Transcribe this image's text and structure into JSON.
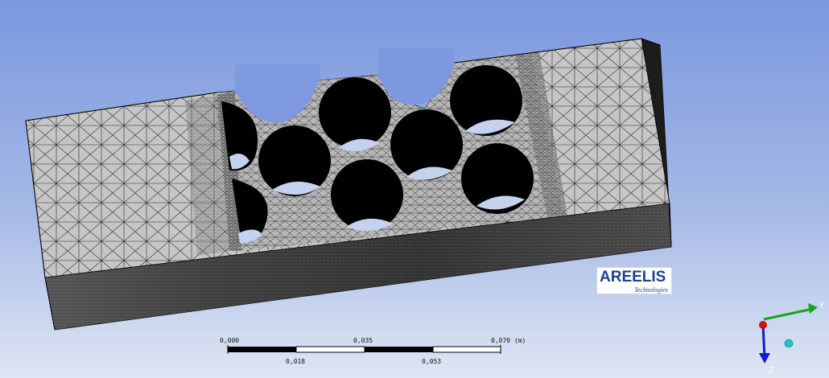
{
  "logo": {
    "text_main": "AREELIS",
    "text_sub": "Technologies"
  },
  "scale_bar": {
    "labels_top": [
      "0,000",
      "0,035",
      "0,070 (m)"
    ],
    "labels_bottom": [
      "0,018",
      "0,053"
    ]
  },
  "triad": {
    "axis_y": "Y",
    "axis_z": "Z"
  },
  "colors": {
    "mesh_face": "#c4c4c4",
    "mesh_lines": "#1a1a1a",
    "background_top": "#7b98de",
    "background_bottom": "#dfe6f4",
    "axis_y": "#1aa31a",
    "axis_z": "#1020c8",
    "axis_origin": "#d01010",
    "axis_sphere": "#20c0c0"
  }
}
